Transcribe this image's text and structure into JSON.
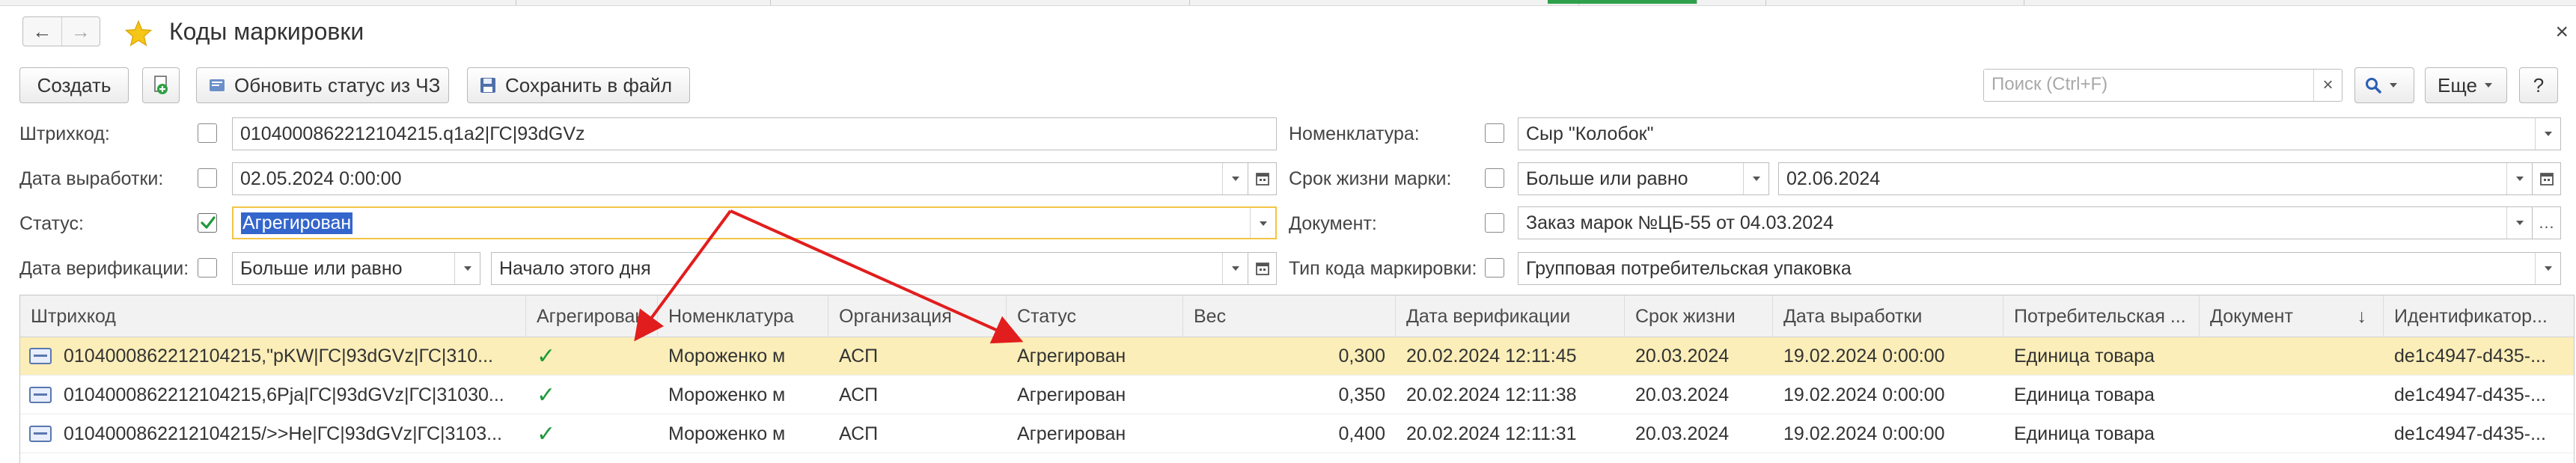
{
  "window": {
    "title": "Коды маркировки",
    "back_glyph": "←",
    "forward_glyph": "→",
    "close_glyph": "×",
    "favorite_icon": "star-icon"
  },
  "toolbar": {
    "create_label": "Создать",
    "update_status_label": "Обновить статус из ЧЗ",
    "save_file_label": "Сохранить в файл",
    "search_placeholder": "Поиск (Ctrl+F)",
    "search_clear": "×",
    "more_label": "Еще",
    "help_label": "?"
  },
  "filters": {
    "barcode": {
      "label": "Штрихкод:",
      "checked": false,
      "value": "0104000862212104215.q1a2|ГС|93dGVz"
    },
    "production_date": {
      "label": "Дата выработки:",
      "checked": false,
      "value": "02.05.2024  0:00:00"
    },
    "status": {
      "label": "Статус:",
      "checked": true,
      "value": "Агрегирован"
    },
    "verification_date": {
      "label": "Дата верификации:",
      "checked": false,
      "condition": "Больше или равно",
      "value": "Начало этого дня"
    },
    "nomenclature": {
      "label": "Номенклатура:",
      "checked": false,
      "value": "Сыр \"Колобок\""
    },
    "shelf_life": {
      "label": "Срок жизни марки:",
      "checked": false,
      "condition": "Больше или равно",
      "value": "02.06.2024"
    },
    "document": {
      "label": "Документ:",
      "checked": false,
      "value": "Заказ марок №ЦБ-55 от 04.03.2024"
    },
    "code_type": {
      "label": "Тип кода маркировки:",
      "checked": false,
      "value": "Групповая потребительская упаковка"
    }
  },
  "table": {
    "columns": [
      "Штрихкод",
      "Агрегирован",
      "Номенклатура",
      "Организация",
      "Статус",
      "Вес",
      "Дата верификации",
      "Срок жизни",
      "Дата выработки",
      "Потребительская ...",
      "Документ",
      "Идентификатор..."
    ],
    "sort_indicator": "↓",
    "rows": [
      {
        "barcode": "0104000862212104215,\"pKW|ГС|93dGVz|ГС|310...",
        "aggregated": "✓",
        "nomenclature": "Мороженко м",
        "organization": "АСП",
        "status": "Агрегирован",
        "weight": "0,300",
        "verification": "20.02.2024 12:11:45",
        "shelf_life": "20.03.2024",
        "production": "19.02.2024 0:00:00",
        "consumer": "Единица товара",
        "document": "",
        "identifier": "de1c4947-d435-..."
      },
      {
        "barcode": "0104000862212104215,6Pja|ГС|93dGVz|ГС|31030...",
        "aggregated": "✓",
        "nomenclature": "Мороженко м",
        "organization": "АСП",
        "status": "Агрегирован",
        "weight": "0,350",
        "verification": "20.02.2024 12:11:38",
        "shelf_life": "20.03.2024",
        "production": "19.02.2024 0:00:00",
        "consumer": "Единица товара",
        "document": "",
        "identifier": "de1c4947-d435-..."
      },
      {
        "barcode": "0104000862212104215/>>He|ГС|93dGVz|ГС|3103...",
        "aggregated": "✓",
        "nomenclature": "Мороженко м",
        "organization": "АСП",
        "status": "Агрегирован",
        "weight": "0,400",
        "verification": "20.02.2024 12:11:31",
        "shelf_life": "20.03.2024",
        "production": "19.02.2024 0:00:00",
        "consumer": "Единица товара",
        "document": "",
        "identifier": "de1c4947-d435-..."
      }
    ]
  },
  "colors": {
    "selected_row": "#fbeeb8",
    "focus_border": "#f3c444",
    "check_green": "#1e9a3b",
    "annotation_arrow": "#e21d1d",
    "star": "#f5c518"
  }
}
